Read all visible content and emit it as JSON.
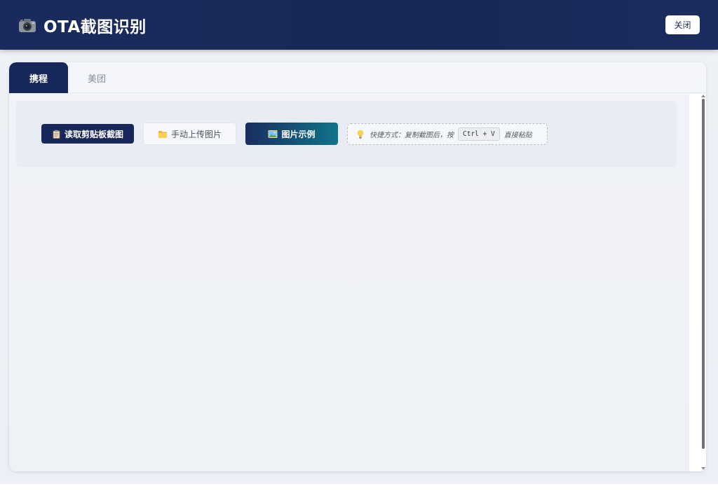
{
  "header": {
    "title": "OTA截图识别",
    "close_label": "关闭"
  },
  "tabs": [
    {
      "label": "携程",
      "active": true
    },
    {
      "label": "美团",
      "active": false
    }
  ],
  "toolbar": {
    "clipboard_label": "读取剪贴板截图",
    "upload_label": "手动上传图片",
    "example_label": "图片示例"
  },
  "tip": {
    "prefix": "快捷方式：复制截图后，按",
    "shortcut": "Ctrl + V",
    "suffix": "直接粘贴"
  },
  "icons": {
    "header": "camera-icon",
    "clipboard": "clipboard-icon",
    "upload": "folder-icon",
    "example": "picture-icon",
    "tip": "lightbulb-icon"
  },
  "colors": {
    "primary": "#17275a",
    "accent_gradient_end": "#0f7489",
    "background": "#eef1f6"
  }
}
